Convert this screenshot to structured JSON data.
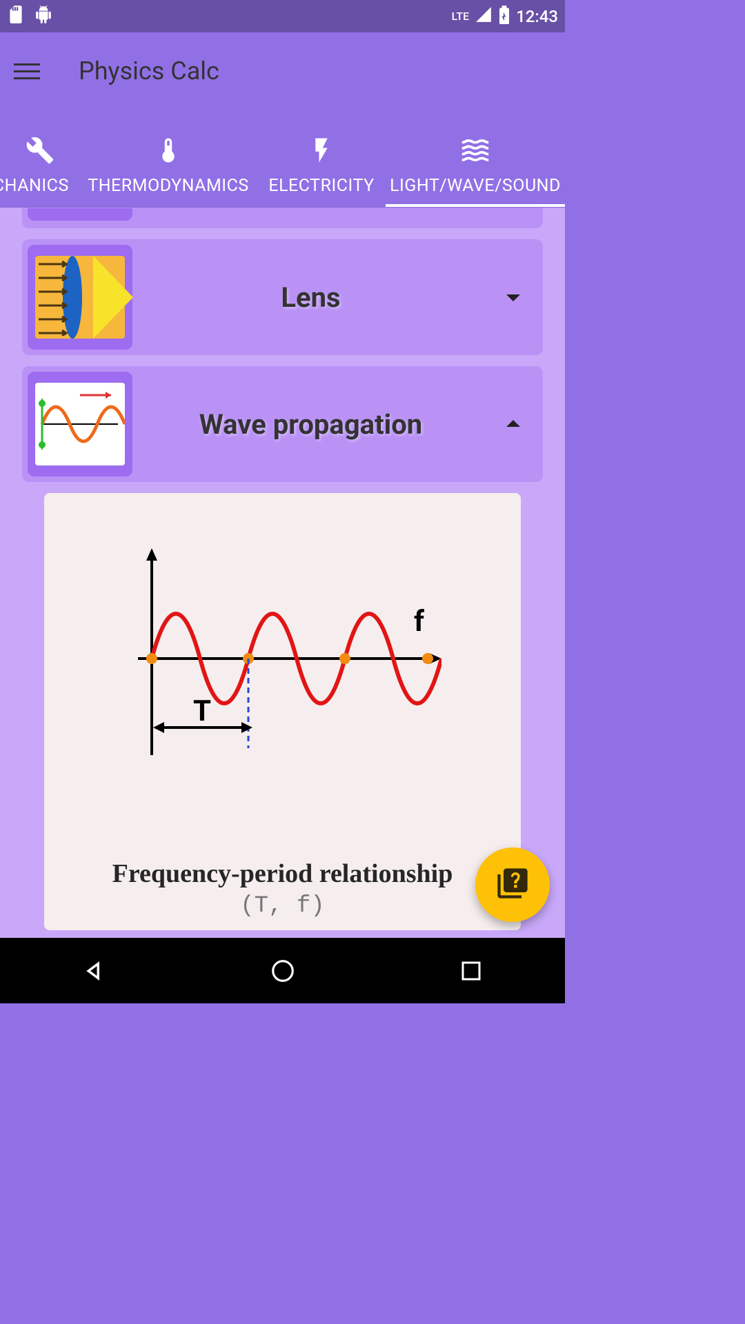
{
  "status": {
    "time": "12:43",
    "lte": "LTE"
  },
  "app": {
    "title": "Physics Calc"
  },
  "tabs": [
    {
      "label": "ECHANICS"
    },
    {
      "label": "THERMODYNAMICS"
    },
    {
      "label": "ELECTRICITY"
    },
    {
      "label": "LIGHT/WAVE/SOUND"
    }
  ],
  "cards": {
    "lens": {
      "title": "Lens"
    },
    "wave": {
      "title": "Wave propagation"
    }
  },
  "detail": {
    "title": "Frequency-period relationship",
    "subtitle": "(T, f)",
    "diagram_labels": {
      "period": "T",
      "freq": "f"
    }
  }
}
